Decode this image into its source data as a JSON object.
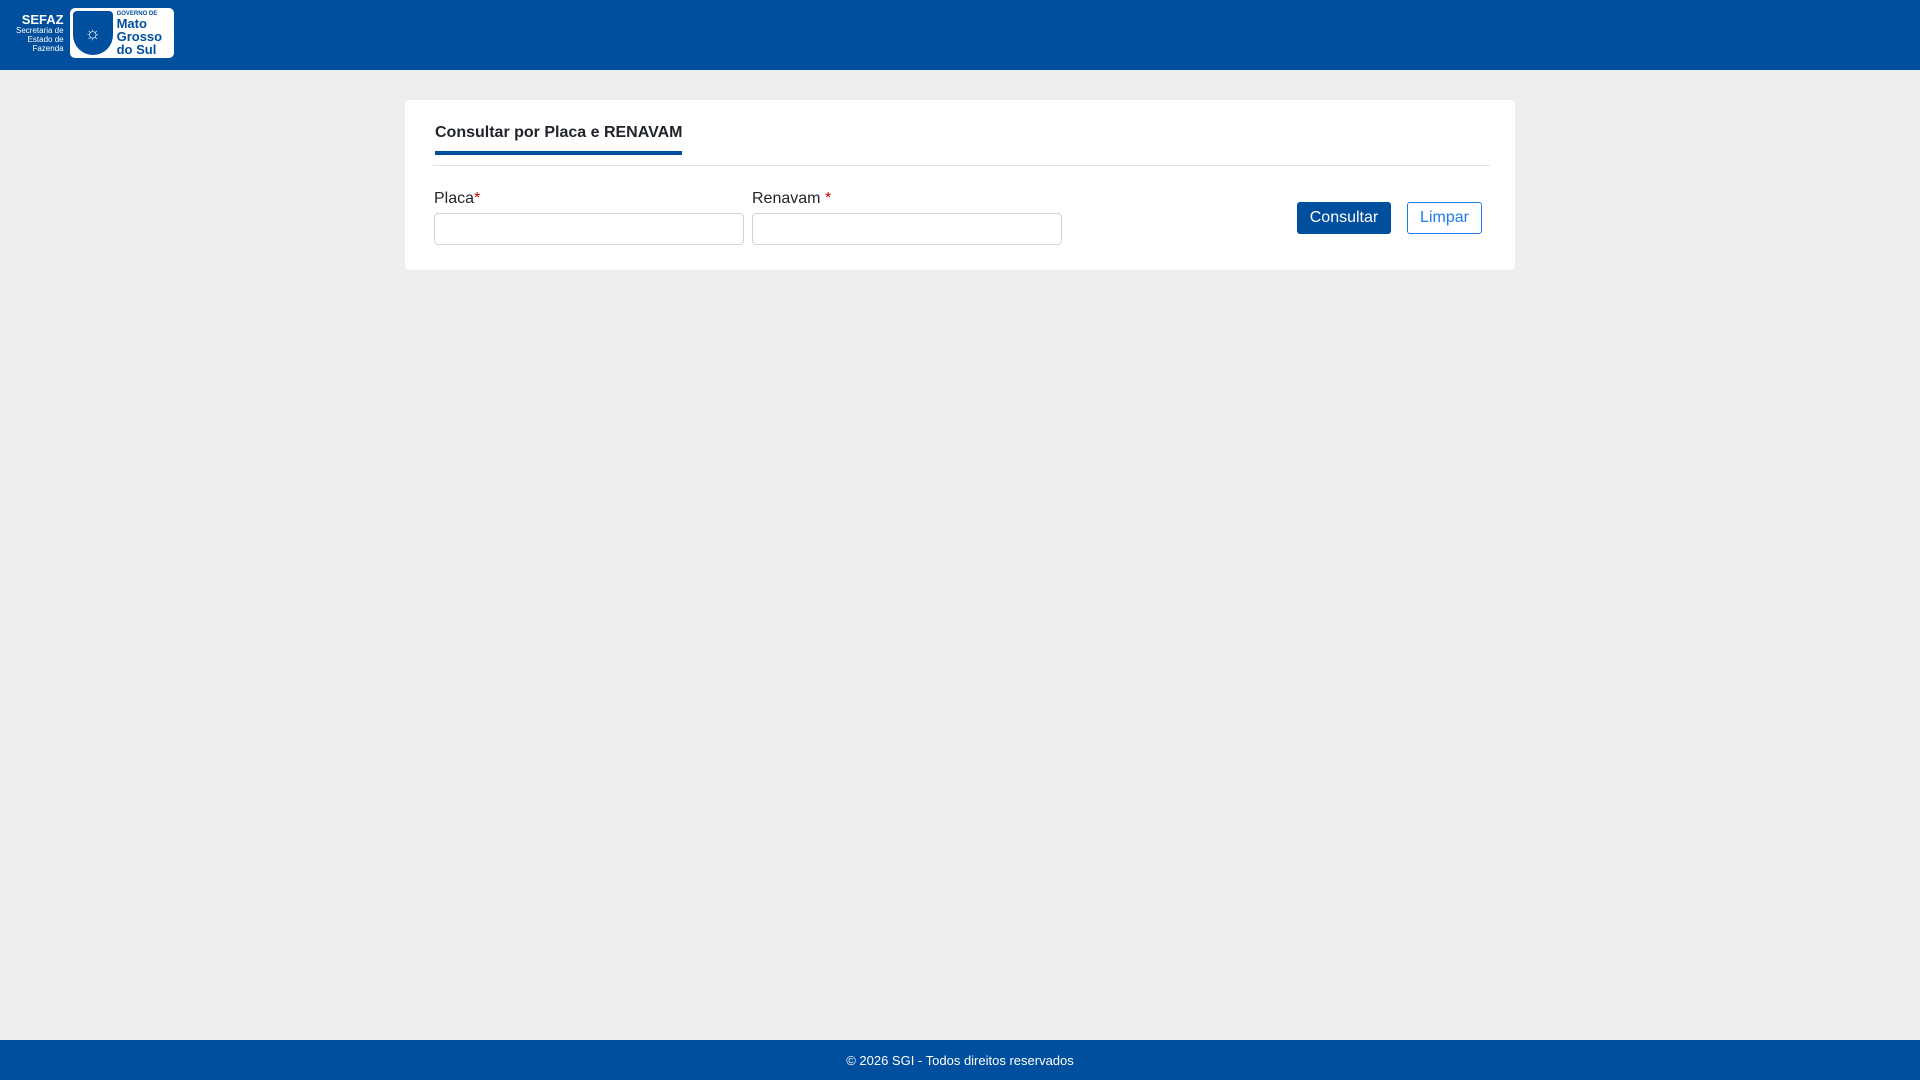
{
  "header": {
    "logo": {
      "sefaz": "SEFAZ",
      "sefaz_sub": [
        "Secretaria de",
        "Estado de",
        "Fazenda"
      ],
      "gov_small": "GOVERNO DE",
      "gov_big": [
        "Mato",
        "Grosso",
        "do Sul"
      ]
    }
  },
  "card": {
    "tab_label": "Consultar por Placa e RENAVAM",
    "fields": [
      {
        "label": "Placa",
        "required": "*",
        "value": "",
        "placeholder": ""
      },
      {
        "label": "Renavam",
        "required": "*",
        "value": "",
        "placeholder": ""
      }
    ],
    "buttons": {
      "consultar": "Consultar",
      "limpar": "Limpar"
    }
  },
  "footer": {
    "text": "© 2026 SGI - Todos direitos reservados"
  },
  "colors": {
    "brand": "#004f9f",
    "required": "#cc0000",
    "link": "#1f7bf0"
  }
}
